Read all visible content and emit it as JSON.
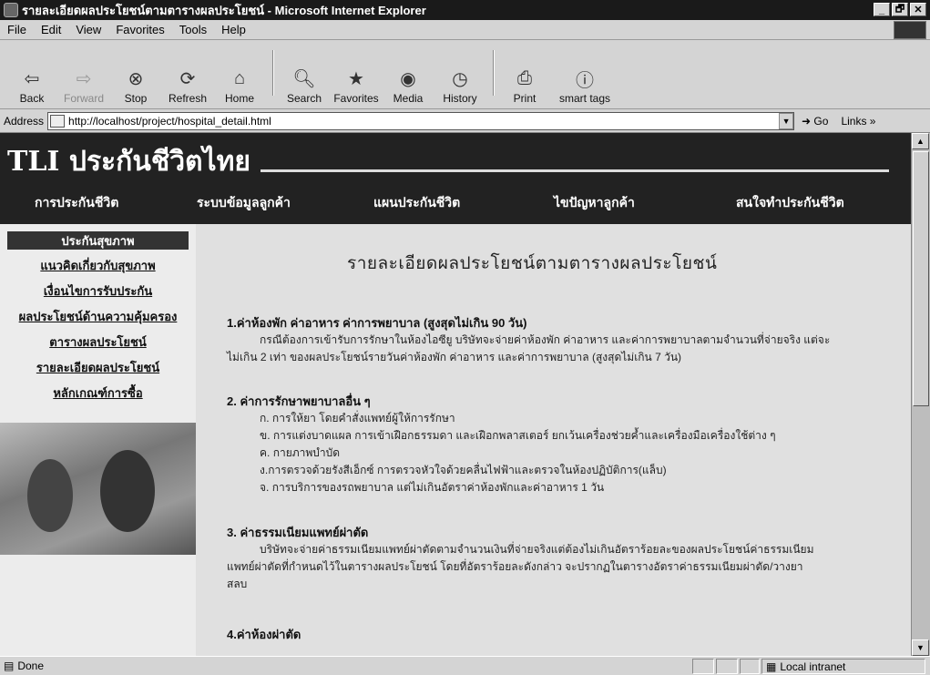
{
  "window": {
    "title": "รายละเอียดผลประโยชน์ตามตารางผลประโยชน์ - Microsoft Internet Explorer",
    "buttons": [
      "_",
      "🗗",
      "✕"
    ]
  },
  "menu": [
    "File",
    "Edit",
    "View",
    "Favorites",
    "Tools",
    "Help"
  ],
  "toolbar": {
    "back": "Back",
    "forward": "Forward",
    "stop": "Stop",
    "refresh": "Refresh",
    "home": "Home",
    "search": "Search",
    "favorites": "Favorites",
    "media": "Media",
    "history": "History",
    "print": "Print",
    "smarttags": "smart tags"
  },
  "address": {
    "label": "Address",
    "url": "http://localhost/project/hospital_detail.html",
    "go": "Go",
    "links": "Links »"
  },
  "site": {
    "logo": "TLI ประกันชีวิตไทย",
    "nav": [
      "การประกันชีวิต",
      "ระบบข้อมูลลูกค้า",
      "แผนประกันชีวิต",
      "ไขปัญหาลูกค้า",
      "สนใจทำประกันชีวิต"
    ]
  },
  "sidebar": {
    "heading": "ประกันสุขภาพ",
    "links": [
      "แนวคิดเกี่ยวกับสุขภาพ",
      "เงื่อนไขการรับประกัน",
      "ผลประโยชน์ด้านความคุ้มครอง",
      "ตารางผลประโยชน์",
      "รายละเอียดผลประโยชน์",
      "หลักเกณฑ์การซื้อ"
    ]
  },
  "content": {
    "title": "รายละเอียดผลประโยชน์ตามตารางผลประโยชน์",
    "s1_head": "1.ค่าห้องพัก ค่าอาหาร ค่าการพยาบาล (สูงสุดไม่เกิน 90 วัน)",
    "s1_l1": "กรณีต้องการเข้ารับการรักษาในห้องไอซียู บริษัทจะจ่ายค่าห้องพัก ค่าอาหาร และค่าการพยาบาลตามจำนวนที่จ่ายจริง แต่จะ",
    "s1_l2": "ไม่เกิน 2 เท่า ของผลประโยชน์รายวันค่าห้องพัก ค่าอาหาร และค่าการพยาบาล (สูงสุดไม่เกิน 7 วัน)",
    "s2_head": "2. ค่าการรักษาพยาบาลอื่น ๆ",
    "s2_a": "ก. การให้ยา โดยคำสั่งแพทย์ผู้ให้การรักษา",
    "s2_b": "ข. การแต่งบาดแผล การเข้าเฝือกธรรมดา และเฝือกพลาสเตอร์ ยกเว้นเครื่องช่วยค้ำและเครื่องมือเครื่องใช้ต่าง ๆ",
    "s2_c": "ค. กายภาพบำบัด",
    "s2_d": "ง.การตรวจด้วยรังสีเอ็กซ์ การตรวจหัวใจด้วยคลื่นไฟฟ้าและตรวจในห้องปฏิบัติการ(แล็บ)",
    "s2_e": "จ. การบริการของรถพยาบาล แต่ไม่เกินอัตราค่าห้องพักและค่าอาหาร 1 วัน",
    "s3_head": "3. ค่าธรรมเนียมแพทย์ผ่าตัด",
    "s3_l1": "บริษัทจะจ่ายค่าธรรมเนียมแพทย์ผ่าตัดตามจำนวนเงินที่จ่ายจริงแต่ต้องไม่เกินอัตราร้อยละของผลประโยชน์ค่าธรรมเนียม",
    "s3_l2": "แพทย์ผ่าตัดที่กำหนดไว้ในตารางผลประโยชน์ โดยที่อัตราร้อยละดังกล่าว จะปรากฏในตารางอัตราค่าธรรมเนียมผ่าตัด/วางยา",
    "s3_l3": "สลบ",
    "s4_head": "4.ค่าห้องผ่าตัด"
  },
  "status": {
    "text": "Done",
    "zone": "Local intranet"
  }
}
